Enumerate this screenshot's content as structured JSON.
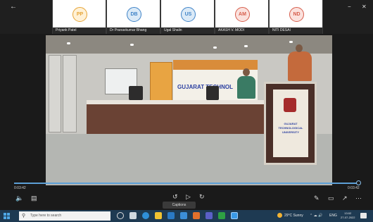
{
  "participants": [
    {
      "initials": "PP",
      "name": "Priyank Patel",
      "bg": "#fff1d6",
      "fg": "#e6a437"
    },
    {
      "initials": "DB",
      "name": "Dr Pranavkumar Bhang",
      "bg": "#dbeaf7",
      "fg": "#3f83c7"
    },
    {
      "initials": "US",
      "name": "Ugal Shalin",
      "bg": "#dbeaf7",
      "fg": "#3f83c7"
    },
    {
      "initials": "AM",
      "name": "AKASH V. MODI",
      "bg": "#fbe1dd",
      "fg": "#d65d4b"
    },
    {
      "initials": "ND",
      "name": "NITI DESAI",
      "bg": "#fbe1dd",
      "fg": "#d65d4b"
    }
  ],
  "window": {
    "back_icon": "arrow-left-icon",
    "minimize_icon": "minimize-icon",
    "close_icon": "close-icon"
  },
  "video": {
    "banner_text": "GUJARAT TECHNOL",
    "podium_text": "GUJARAT TECHNOLOGICAL UNIVERSITY"
  },
  "player": {
    "current_time": "0:03:42",
    "total_time": "0:03:42",
    "progress": 1.0,
    "accent": "#5d9fd6",
    "tooltip": "Captions"
  },
  "taskbar": {
    "search_placeholder": "Type here to search",
    "weather": "29°C Sunny",
    "language": "ENG",
    "time": "13:02",
    "date": "27-07-2022"
  }
}
